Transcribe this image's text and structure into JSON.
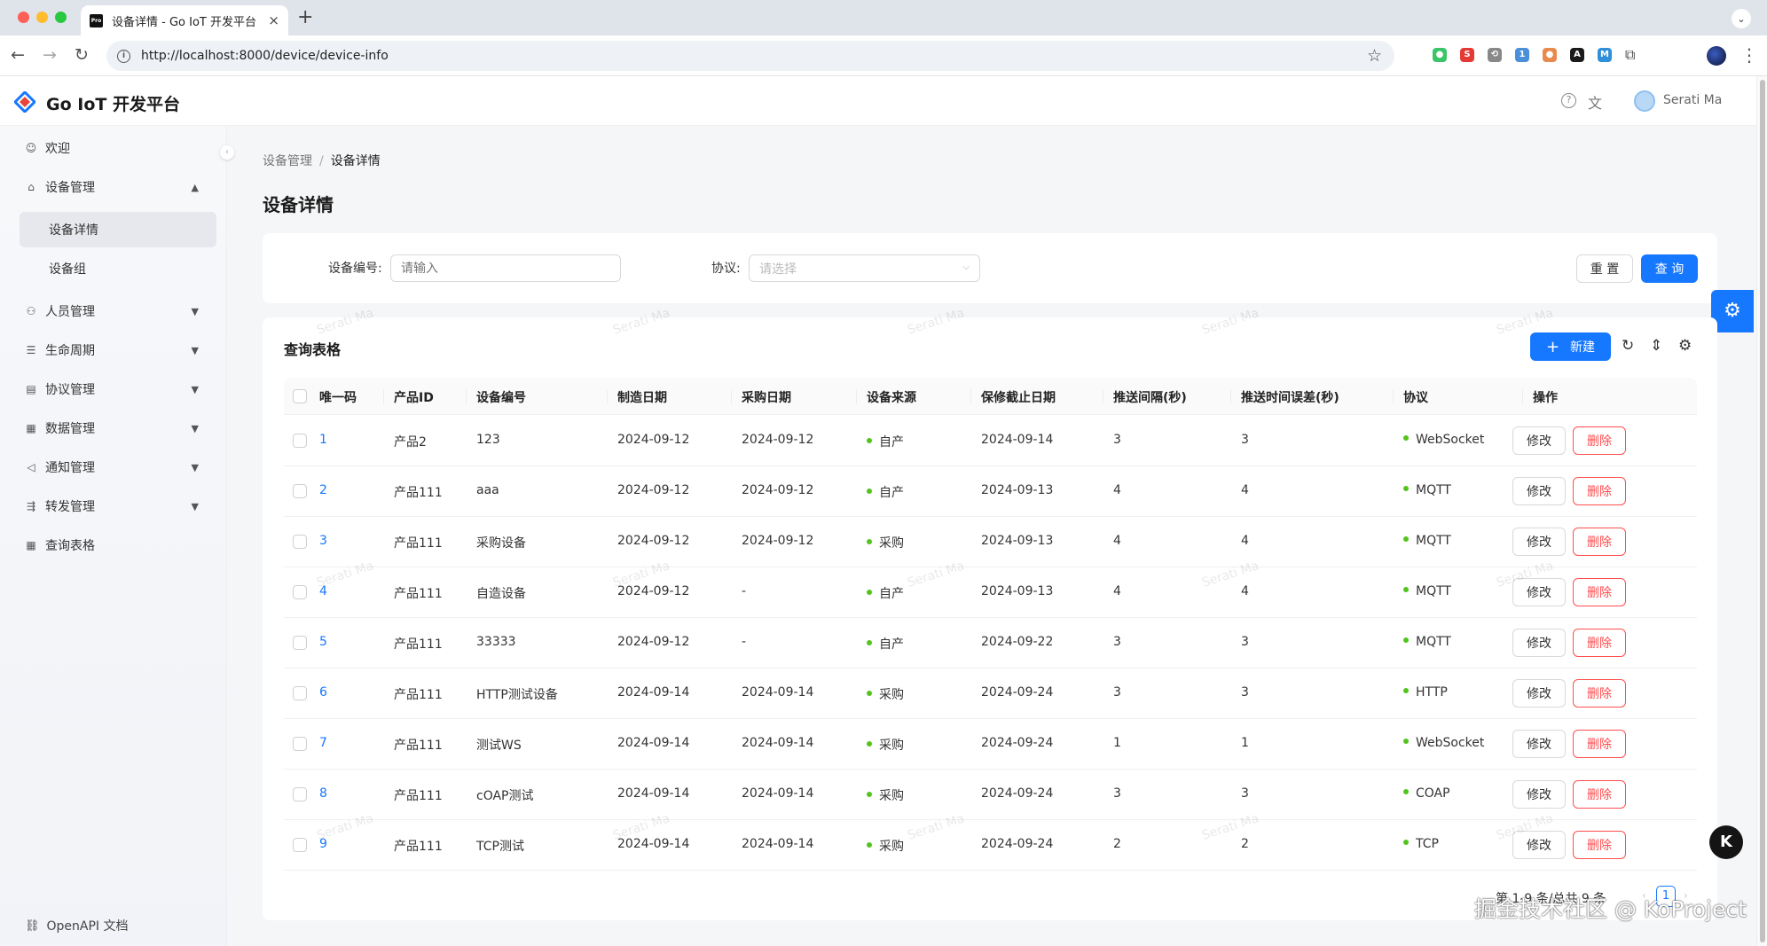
{
  "browser": {
    "tab_title": "设备详情 - Go IoT 开发平台",
    "tab_favicon": "Pro",
    "url": "http://localhost:8000/device/device-info",
    "extensions": [
      {
        "icon": "green-circle-ext",
        "color": "#3ac569",
        "glyph": "●"
      },
      {
        "icon": "red-s-ext",
        "color": "#e53935",
        "glyph": "S"
      },
      {
        "icon": "history-ext",
        "color": "#888888",
        "glyph": "⟲"
      },
      {
        "icon": "blue-badge-ext",
        "color": "#4a90d9",
        "glyph": "1"
      },
      {
        "icon": "orange-ext",
        "color": "#e88a4d",
        "glyph": "●"
      },
      {
        "icon": "black-a-ext",
        "color": "#1a1a1a",
        "glyph": "A"
      },
      {
        "icon": "m-ext",
        "color": "#2f8fd8",
        "glyph": "M"
      }
    ]
  },
  "header": {
    "app_title": "Go IoT 开发平台",
    "user_name": "Serati Ma"
  },
  "sidebar": {
    "items": [
      {
        "label": "欢迎",
        "icon": "smile-icon"
      },
      {
        "label": "设备管理",
        "icon": "device-icon"
      },
      {
        "label": "人员管理",
        "icon": "user-icon"
      },
      {
        "label": "生命周期",
        "icon": "list-icon"
      },
      {
        "label": "协议管理",
        "icon": "protocol-icon"
      },
      {
        "label": "数据管理",
        "icon": "table-icon"
      },
      {
        "label": "通知管理",
        "icon": "notify-icon"
      },
      {
        "label": "转发管理",
        "icon": "forward-icon"
      },
      {
        "label": "查询表格",
        "icon": "table-icon"
      }
    ],
    "sub_items": [
      "设备详情",
      "设备组"
    ],
    "footer": "OpenAPI 文档"
  },
  "breadcrumb": {
    "parent": "设备管理",
    "separator": "/",
    "current": "设备详情"
  },
  "page_title": "设备详情",
  "filter": {
    "device_no_label": "设备编号:",
    "device_no_placeholder": "请输入",
    "protocol_label": "协议:",
    "protocol_placeholder": "请选择",
    "reset_label": "重 置",
    "query_label": "查 询"
  },
  "table": {
    "title": "查询表格",
    "new_label": "新建",
    "columns": [
      "唯一码",
      "产品ID",
      "设备编号",
      "制造日期",
      "采购日期",
      "设备来源",
      "保修截止日期",
      "推送间隔(秒)",
      "推送时间误差(秒)",
      "协议",
      "操作"
    ],
    "rows": [
      {
        "id": "1",
        "product": "产品2",
        "device_no": "123",
        "mfg": "2024-09-12",
        "purchase": "2024-09-12",
        "source": "自产",
        "warranty": "2024-09-14",
        "interval": "3",
        "error": "3",
        "protocol": "WebSocket"
      },
      {
        "id": "2",
        "product": "产品111",
        "device_no": "aaa",
        "mfg": "2024-09-12",
        "purchase": "2024-09-12",
        "source": "自产",
        "warranty": "2024-09-13",
        "interval": "4",
        "error": "4",
        "protocol": "MQTT"
      },
      {
        "id": "3",
        "product": "产品111",
        "device_no": "采购设备",
        "mfg": "2024-09-12",
        "purchase": "2024-09-12",
        "source": "采购",
        "warranty": "2024-09-13",
        "interval": "4",
        "error": "4",
        "protocol": "MQTT"
      },
      {
        "id": "4",
        "product": "产品111",
        "device_no": "自造设备",
        "mfg": "2024-09-12",
        "purchase": "-",
        "source": "自产",
        "warranty": "2024-09-13",
        "interval": "4",
        "error": "4",
        "protocol": "MQTT"
      },
      {
        "id": "5",
        "product": "产品111",
        "device_no": "33333",
        "mfg": "2024-09-12",
        "purchase": "-",
        "source": "自产",
        "warranty": "2024-09-22",
        "interval": "3",
        "error": "3",
        "protocol": "MQTT"
      },
      {
        "id": "6",
        "product": "产品111",
        "device_no": "HTTP测试设备",
        "mfg": "2024-09-14",
        "purchase": "2024-09-14",
        "source": "采购",
        "warranty": "2024-09-24",
        "interval": "3",
        "error": "3",
        "protocol": "HTTP"
      },
      {
        "id": "7",
        "product": "产品111",
        "device_no": "测试WS",
        "mfg": "2024-09-14",
        "purchase": "2024-09-14",
        "source": "采购",
        "warranty": "2024-09-24",
        "interval": "1",
        "error": "1",
        "protocol": "WebSocket"
      },
      {
        "id": "8",
        "product": "产品111",
        "device_no": "cOAP测试",
        "mfg": "2024-09-14",
        "purchase": "2024-09-14",
        "source": "采购",
        "warranty": "2024-09-24",
        "interval": "3",
        "error": "3",
        "protocol": "COAP"
      },
      {
        "id": "9",
        "product": "产品111",
        "device_no": "TCP测试",
        "mfg": "2024-09-14",
        "purchase": "2024-09-14",
        "source": "采购",
        "warranty": "2024-09-24",
        "interval": "2",
        "error": "2",
        "protocol": "TCP"
      }
    ],
    "edit_label": "修改",
    "delete_label": "删除",
    "status_dot_color": "#52c41a"
  },
  "pagination": {
    "summary": "第 1-9 条/总共 9 条",
    "current_page": "1"
  },
  "watermark_text": "Serati Ma",
  "corner_watermark": "掘金技术社区 @ KoProject",
  "colors": {
    "primary": "#1677ff",
    "danger": "#ff4d4f",
    "success": "#52c41a"
  }
}
